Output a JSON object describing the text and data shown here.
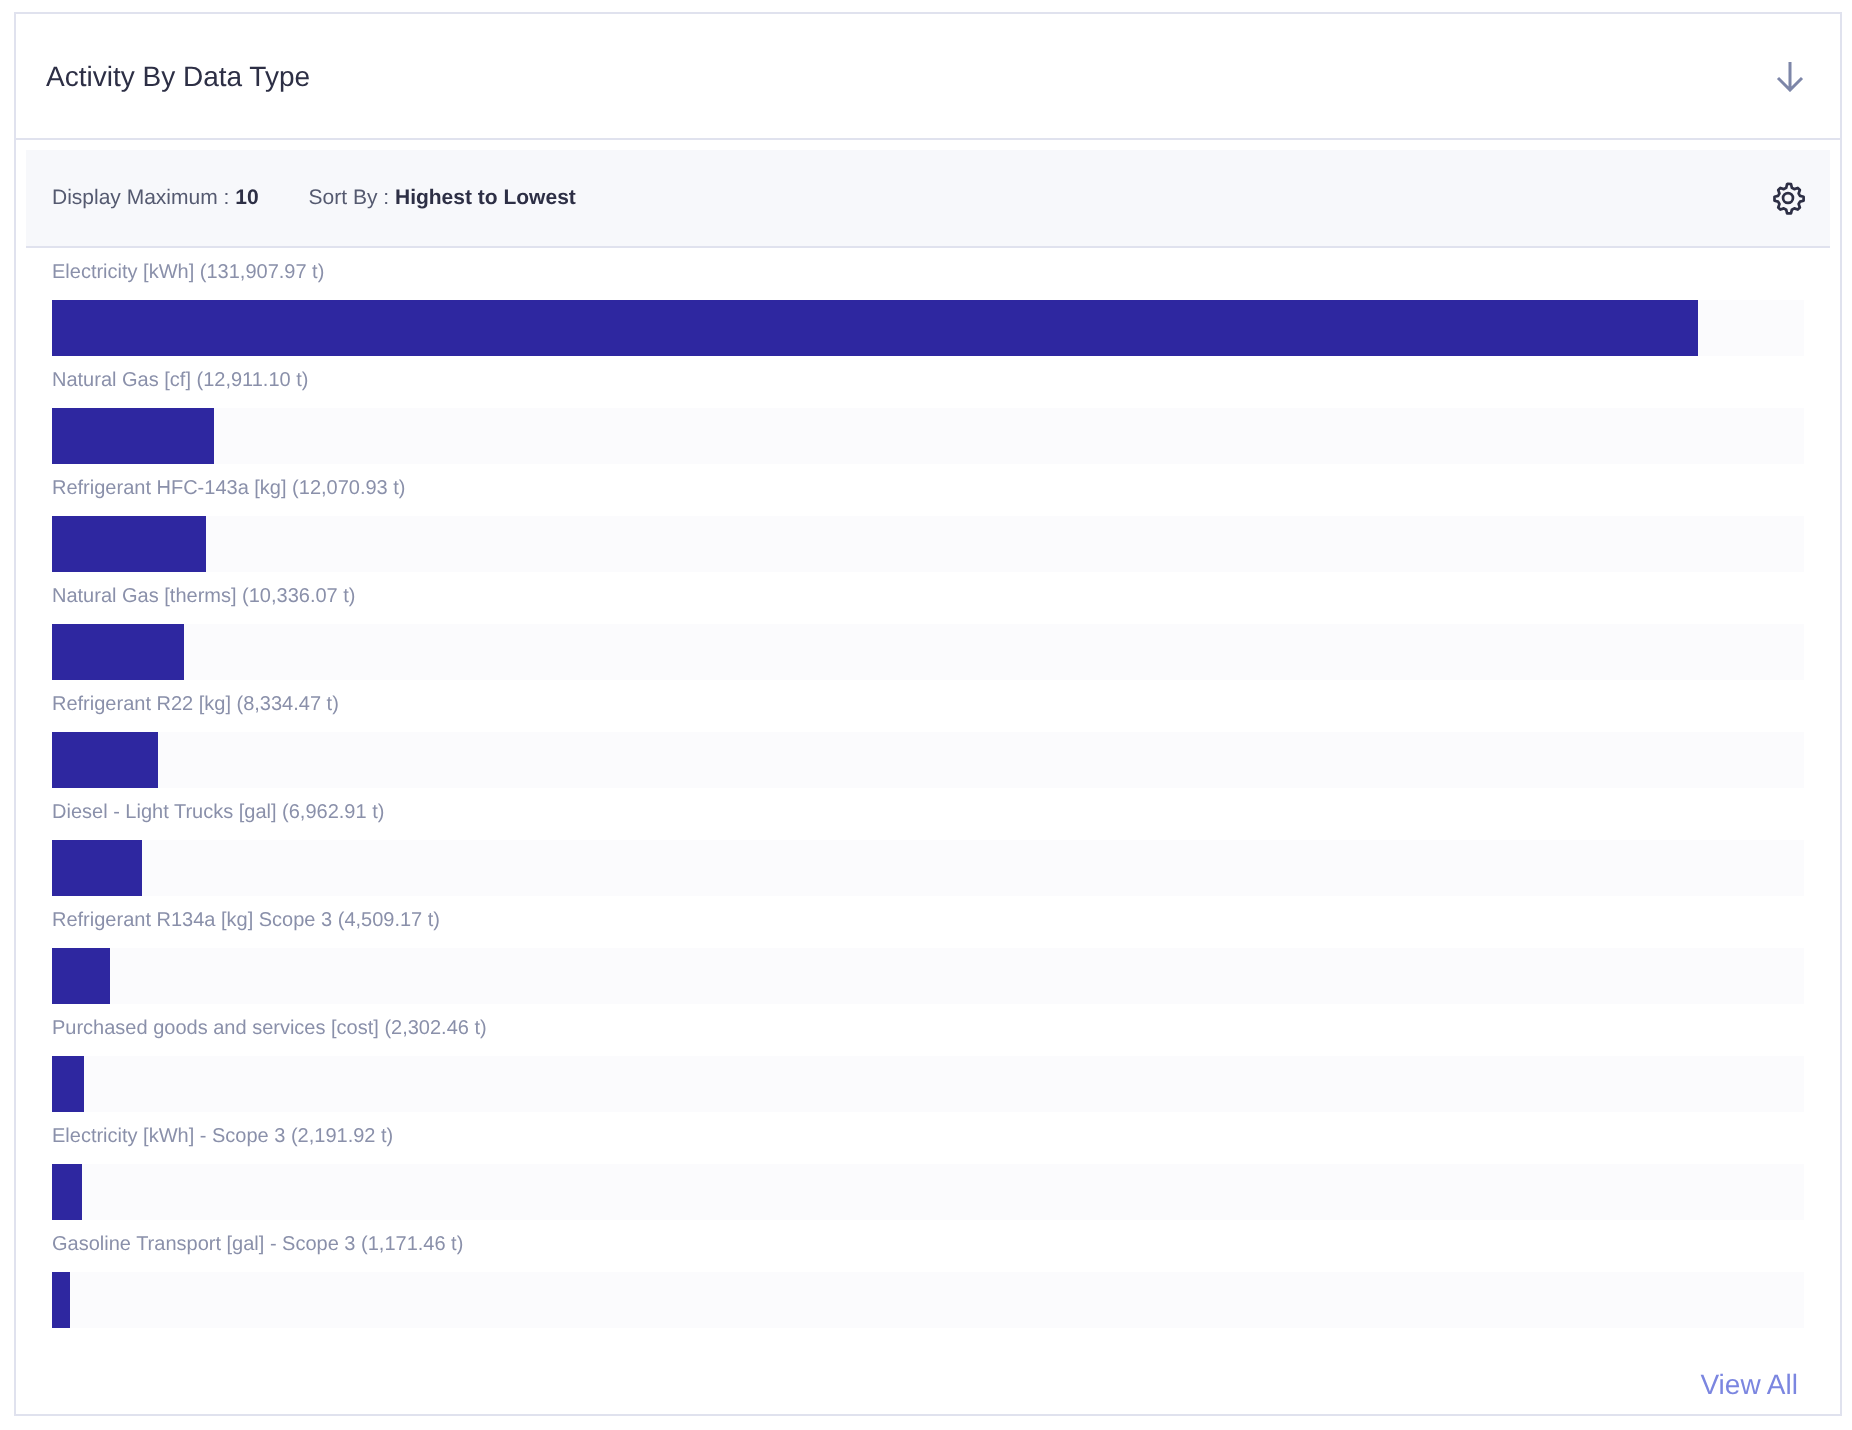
{
  "panel": {
    "title": "Activity By Data Type"
  },
  "toolbar": {
    "display_maximum": {
      "label": "Display Maximum :",
      "value": "10"
    },
    "sort_by": {
      "label": "Sort By :",
      "value": "Highest to Lowest"
    }
  },
  "bars": [
    {
      "label": "Electricity [kWh] (131,907.97 t)",
      "level": 0.939
    },
    {
      "label": "Natural Gas [cf] (12,911.10 t)",
      "level": 0.092
    },
    {
      "label": "Refrigerant HFC-143a [kg] (12,070.93 t)",
      "level": 0.088
    },
    {
      "label": "Natural Gas [therms] (10,336.07 t)",
      "level": 0.075
    },
    {
      "label": "Refrigerant R22 [kg] (8,334.47 t)",
      "level": 0.061
    },
    {
      "label": "Diesel - Light Trucks [gal] (6,962.91 t)",
      "level": 0.051
    },
    {
      "label": "Refrigerant R134a [kg] Scope 3 (4,509.17 t)",
      "level": 0.033
    },
    {
      "label": "Purchased goods and services [cost] (2,302.46 t)",
      "level": 0.018
    },
    {
      "label": "Electricity [kWh] - Scope 3 (2,191.92 t)",
      "level": 0.017
    },
    {
      "label": "Gasoline Transport [gal] - Scope 3 (1,171.46 t)",
      "level": 0.01
    }
  ],
  "footer": {
    "link": "View All"
  }
}
